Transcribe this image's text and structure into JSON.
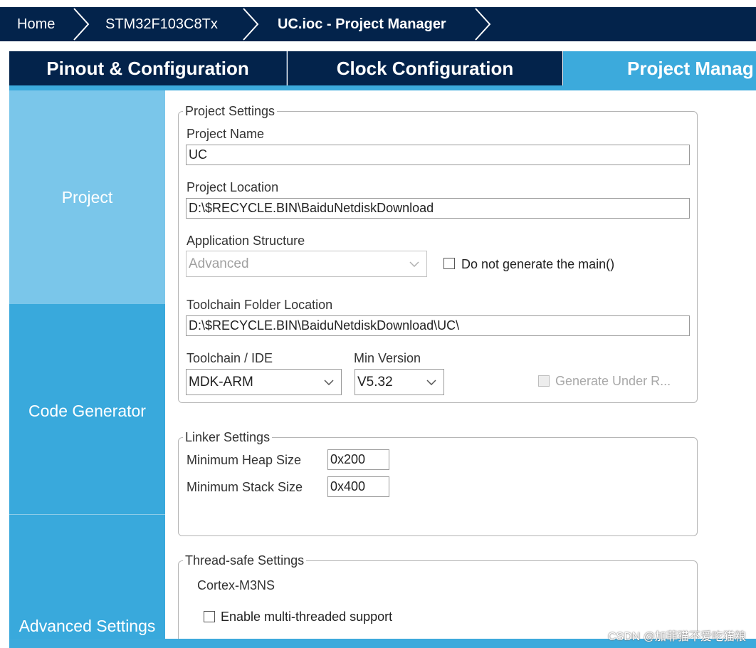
{
  "breadcrumb": {
    "home": "Home",
    "device": "STM32F103C8Tx",
    "project": "UC.ioc - Project Manager"
  },
  "tabs": [
    {
      "label": "Pinout & Configuration"
    },
    {
      "label": "Clock Configuration"
    },
    {
      "label": "Project Manag"
    }
  ],
  "sidebar": {
    "items": [
      {
        "label": "Project"
      },
      {
        "label": "Code Generator"
      },
      {
        "label": "Advanced Settings"
      }
    ]
  },
  "project_settings": {
    "legend": "Project Settings",
    "project_name_label": "Project Name",
    "project_name_value": "UC",
    "project_location_label": "Project Location",
    "project_location_value": "D:\\$RECYCLE.BIN\\BaiduNetdiskDownload",
    "app_structure_label": "Application Structure",
    "app_structure_value": "Advanced",
    "no_main_label": "Do not generate the main()",
    "toolchain_folder_label": "Toolchain Folder Location",
    "toolchain_folder_value": "D:\\$RECYCLE.BIN\\BaiduNetdiskDownload\\UC\\",
    "toolchain_ide_label": "Toolchain / IDE",
    "toolchain_ide_value": "MDK-ARM",
    "min_version_label": "Min Version",
    "min_version_value": "V5.32",
    "generate_under_root_label": "Generate Under R..."
  },
  "linker_settings": {
    "legend": "Linker Settings",
    "heap_label": "Minimum Heap Size",
    "heap_value": "0x200",
    "stack_label": "Minimum Stack Size",
    "stack_value": "0x400"
  },
  "thread_settings": {
    "legend": "Thread-safe Settings",
    "core": "Cortex-M3NS",
    "multithread_label": "Enable multi-threaded support"
  },
  "watermark": "CSDN @加菲猫不爱吃猫粮",
  "colors": {
    "nav_dark": "#03234b",
    "accent_blue": "#3caadc",
    "sidebar_selected": "#7ac6ea"
  }
}
